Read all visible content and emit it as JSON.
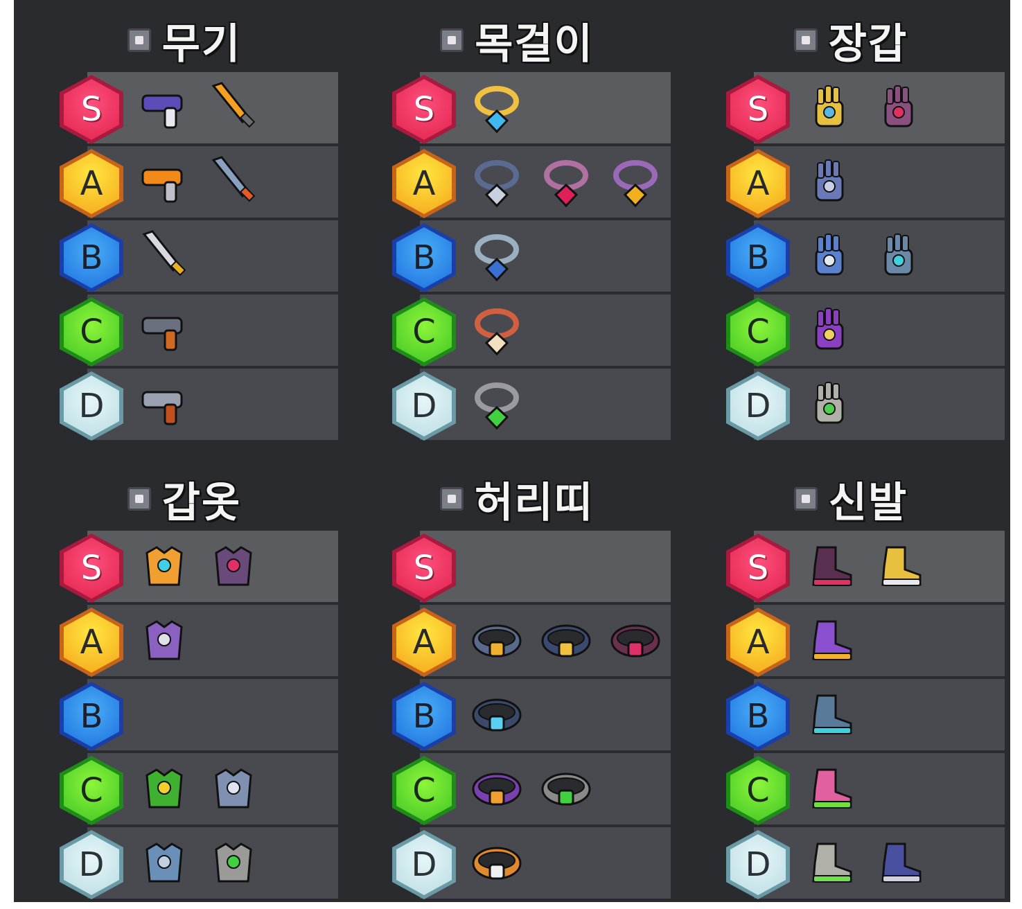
{
  "categories": [
    {
      "title": "무기",
      "icon": "weapon-icon",
      "tiers": [
        {
          "label": "S",
          "items": [
            "pulse-blaster",
            "flame-blade"
          ]
        },
        {
          "label": "A",
          "items": [
            "trumpet-cannon",
            "kunai"
          ]
        },
        {
          "label": "B",
          "items": [
            "katana"
          ]
        },
        {
          "label": "C",
          "items": [
            "shotgun"
          ]
        },
        {
          "label": "D",
          "items": [
            "revolver"
          ]
        }
      ]
    },
    {
      "title": "목걸이",
      "icon": "necklace-icon",
      "tiers": [
        {
          "label": "S",
          "items": [
            "star-pendant"
          ]
        },
        {
          "label": "A",
          "items": [
            "spiked-collar",
            "chain-heart-necklace",
            "padlock-necklace"
          ]
        },
        {
          "label": "B",
          "items": [
            "shield-pendant"
          ]
        },
        {
          "label": "C",
          "items": [
            "fang-necklace"
          ]
        },
        {
          "label": "D",
          "items": [
            "emerald-pendant"
          ]
        }
      ]
    },
    {
      "title": "장갑",
      "icon": "glove-icon",
      "tiers": [
        {
          "label": "S",
          "items": [
            "golden-gauntlet",
            "ruby-gauntlet"
          ]
        },
        {
          "label": "A",
          "items": [
            "steel-glove"
          ]
        },
        {
          "label": "B",
          "items": [
            "frost-claw-glove",
            "crystal-glove"
          ]
        },
        {
          "label": "C",
          "items": [
            "purple-claw-glove"
          ]
        },
        {
          "label": "D",
          "items": [
            "green-gem-glove"
          ]
        }
      ]
    },
    {
      "title": "갑옷",
      "icon": "armor-icon",
      "tiers": [
        {
          "label": "S",
          "items": [
            "mech-armor",
            "dark-plate-armor"
          ]
        },
        {
          "label": "A",
          "items": [
            "purple-vest"
          ]
        },
        {
          "label": "B",
          "items": []
        },
        {
          "label": "C",
          "items": [
            "leaf-armor",
            "silver-armor"
          ]
        },
        {
          "label": "D",
          "items": [
            "denim-vest",
            "emerald-chestplate"
          ]
        }
      ]
    },
    {
      "title": "허리띠",
      "icon": "belt-icon",
      "tiers": [
        {
          "label": "S",
          "items": []
        },
        {
          "label": "A",
          "items": [
            "winged-belt",
            "star-belt",
            "ruby-belt"
          ]
        },
        {
          "label": "B",
          "items": [
            "crystal-belt"
          ]
        },
        {
          "label": "C",
          "items": [
            "purple-belt",
            "emerald-belt"
          ]
        },
        {
          "label": "D",
          "items": [
            "skull-belt"
          ]
        }
      ]
    },
    {
      "title": "신발",
      "icon": "boots-icon",
      "tiers": [
        {
          "label": "S",
          "items": [
            "dark-boots",
            "golden-sneakers"
          ]
        },
        {
          "label": "A",
          "items": [
            "purple-sneakers"
          ]
        },
        {
          "label": "B",
          "items": [
            "cyber-boots"
          ]
        },
        {
          "label": "C",
          "items": [
            "spiked-pink-boots"
          ]
        },
        {
          "label": "D",
          "items": [
            "green-sneakers",
            "navy-boots"
          ]
        }
      ]
    }
  ],
  "colors": {
    "background": "#2a2b2f",
    "row": "#484a4f",
    "S": "#e0234d",
    "A": "#f5a41a",
    "B": "#1c6fe0",
    "C": "#3fc425",
    "D": "#b9dce2"
  }
}
